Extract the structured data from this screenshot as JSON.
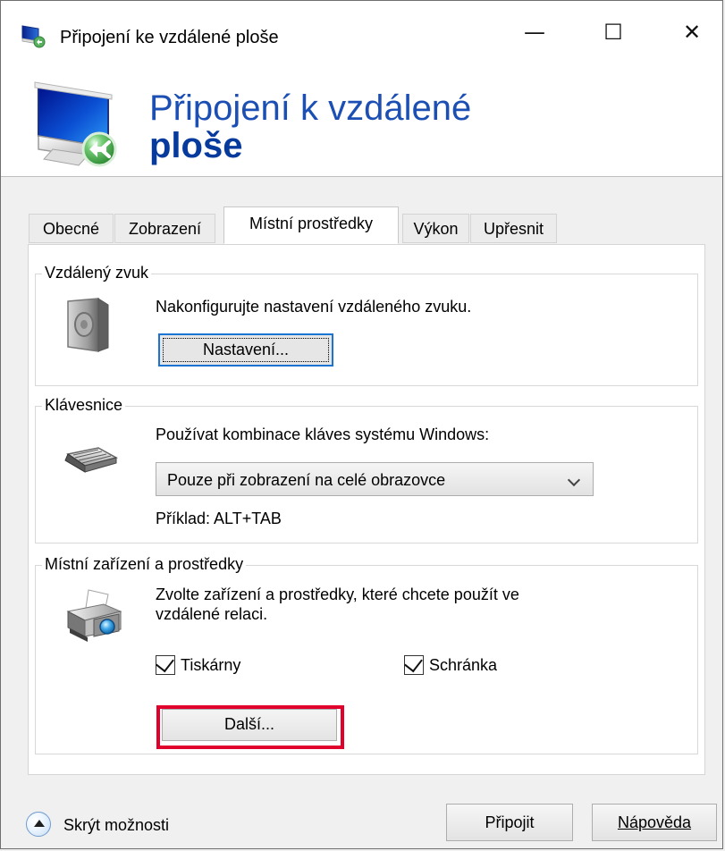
{
  "window": {
    "title": "Připojení ke vzdálené ploše",
    "controls": {
      "minimize": "—",
      "maximize": "☐",
      "close": "✕"
    }
  },
  "header": {
    "title_light": "Připojení k vzdálené",
    "title_bold": "ploše"
  },
  "tabs": [
    {
      "label": "Obecné",
      "active": false
    },
    {
      "label": "Zobrazení",
      "active": false
    },
    {
      "label": "Místní prostředky",
      "active": true
    },
    {
      "label": "Výkon",
      "active": false
    },
    {
      "label": "Upřesnit",
      "active": false
    }
  ],
  "sections": {
    "remote_audio": {
      "label": "Vzdálený zvuk",
      "description": "Nakonfigurujte nastavení vzdáleného zvuku.",
      "button": "Nastavení..."
    },
    "keyboard": {
      "label": "Klávesnice",
      "description": "Používat kombinace kláves systému Windows:",
      "selected_option": "Pouze při zobrazení na celé obrazovce",
      "example": "Příklad: ALT+TAB"
    },
    "local_devices": {
      "label": "Místní zařízení a prostředky",
      "description_line1": "Zvolte zařízení a prostředky, které chcete použít ve",
      "description_line2": "vzdálené relaci.",
      "printers": {
        "label": "Tiskárny",
        "checked": true
      },
      "clipboard": {
        "label": "Schránka",
        "checked": true
      },
      "more_button": "Další..."
    }
  },
  "footer": {
    "hide_options": "Skrýt možnosti",
    "connect": "Připojit",
    "help": "Nápověda"
  },
  "colors": {
    "header_blue": "#1c4fb3",
    "header_bold_blue": "#073a9d",
    "focus_blue": "#1b74d2",
    "highlight_red": "#e0002b"
  },
  "icons": {
    "title": "remote-desktop-icon",
    "header": "remote-desktop-monitor-icon",
    "audio": "speaker-icon",
    "keyboard": "keyboard-icon",
    "devices": "printer-camera-icon",
    "footer": "chevron-up-circle-icon"
  }
}
